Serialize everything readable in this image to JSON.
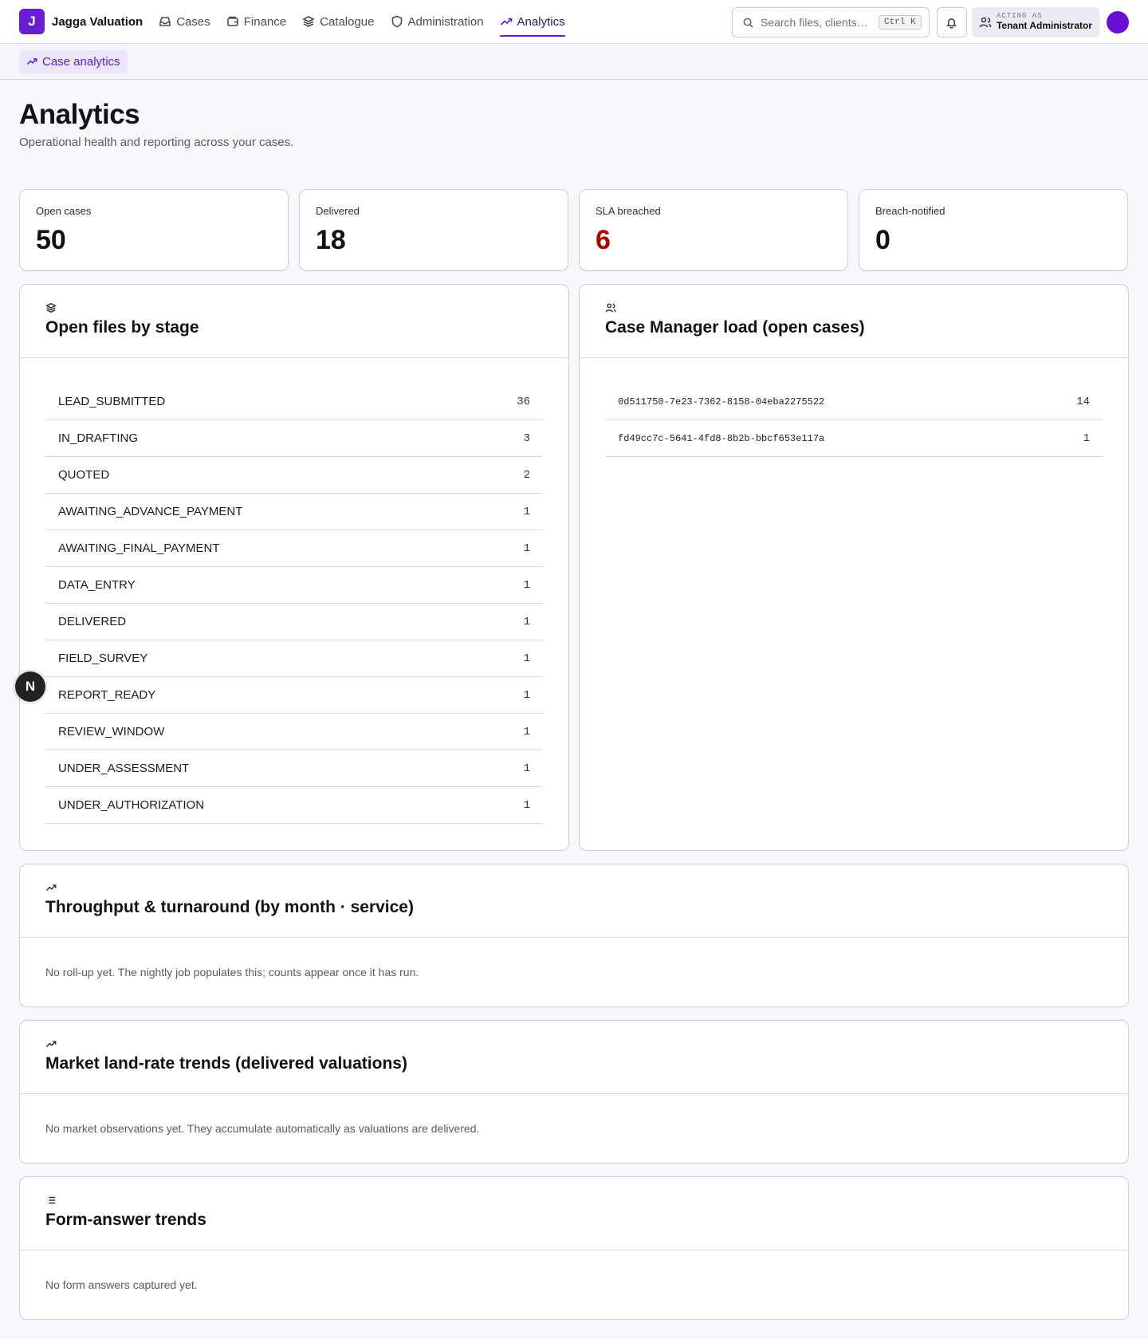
{
  "brand": {
    "logo_letter": "J",
    "name": "Jagga Valuation"
  },
  "nav": [
    {
      "label": "Cases",
      "icon": "inbox-icon"
    },
    {
      "label": "Finance",
      "icon": "wallet-icon"
    },
    {
      "label": "Catalogue",
      "icon": "layers-icon"
    },
    {
      "label": "Administration",
      "icon": "shield-icon"
    },
    {
      "label": "Analytics",
      "icon": "trending-up-icon",
      "active": true
    }
  ],
  "search": {
    "placeholder": "Search files, clients…",
    "shortcut": "Ctrl K"
  },
  "acting": {
    "label": "ACTING AS",
    "role": "Tenant Administrator"
  },
  "subnav": {
    "active_tab": "Case analytics"
  },
  "page": {
    "title": "Analytics",
    "subtitle": "Operational health and reporting across your cases."
  },
  "kpis": [
    {
      "label": "Open cases",
      "value": "50"
    },
    {
      "label": "Delivered",
      "value": "18"
    },
    {
      "label": "SLA breached",
      "value": "6",
      "color": "#b00000"
    },
    {
      "label": "Breach-notified",
      "value": "0"
    }
  ],
  "stages_panel": {
    "title": "Open files by stage",
    "icon": "layers-icon",
    "rows": [
      {
        "label": "LEAD_SUBMITTED",
        "count": "36"
      },
      {
        "label": "IN_DRAFTING",
        "count": "3"
      },
      {
        "label": "QUOTED",
        "count": "2"
      },
      {
        "label": "AWAITING_ADVANCE_PAYMENT",
        "count": "1"
      },
      {
        "label": "AWAITING_FINAL_PAYMENT",
        "count": "1"
      },
      {
        "label": "DATA_ENTRY",
        "count": "1"
      },
      {
        "label": "DELIVERED",
        "count": "1"
      },
      {
        "label": "FIELD_SURVEY",
        "count": "1"
      },
      {
        "label": "REPORT_READY",
        "count": "1"
      },
      {
        "label": "REVIEW_WINDOW",
        "count": "1"
      },
      {
        "label": "UNDER_ASSESSMENT",
        "count": "1"
      },
      {
        "label": "UNDER_AUTHORIZATION",
        "count": "1"
      }
    ]
  },
  "load_panel": {
    "title": "Case Manager load (open cases)",
    "icon": "users-icon",
    "rows": [
      {
        "label": "0d511750-7e23-7362-8158-04eba2275522",
        "count": "14"
      },
      {
        "label": "fd49cc7c-5641-4fd8-8b2b-bbcf653e117a",
        "count": "1"
      }
    ]
  },
  "throughput_panel": {
    "title": "Throughput & turnaround (by month · service)",
    "icon": "trending-up-icon",
    "empty": "No roll-up yet. The nightly job populates this; counts appear once it has run."
  },
  "market_panel": {
    "title": "Market land-rate trends (delivered valuations)",
    "icon": "trending-up-icon",
    "empty": "No market observations yet. They accumulate automatically as valuations are delivered."
  },
  "form_panel": {
    "title": "Form-answer trends",
    "icon": "list-icon",
    "empty": "No form answers captured yet."
  },
  "fab": {
    "letter": "N"
  },
  "colors": {
    "accent": "#5b1fcf",
    "danger": "#b00000",
    "avatar": "#6a0fd8"
  }
}
